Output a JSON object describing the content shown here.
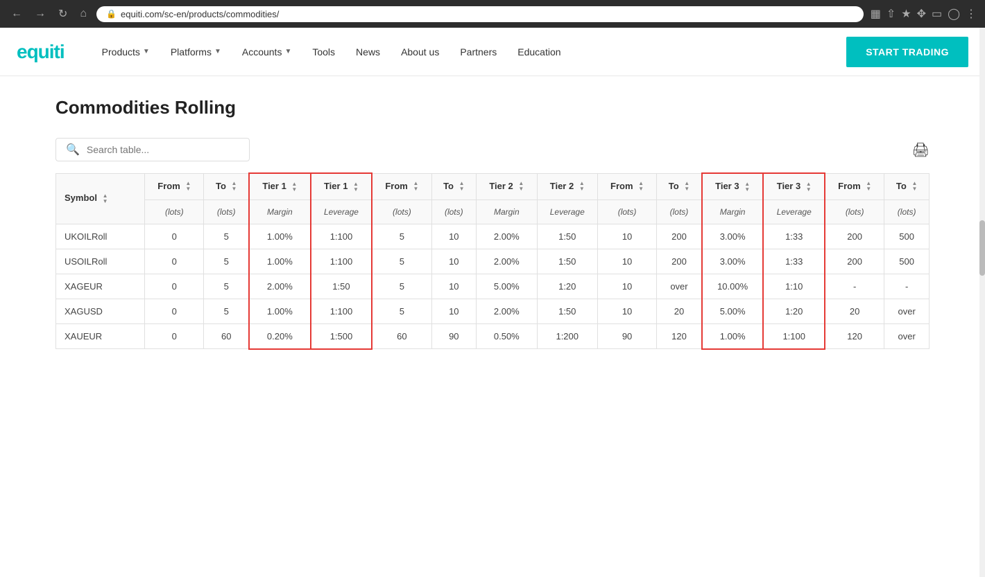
{
  "browser": {
    "url": "equiti.com/sc-en/products/commodities/",
    "back": "←",
    "forward": "→",
    "reload": "↻",
    "home": "⌂"
  },
  "nav": {
    "logo": "equiti",
    "links": [
      {
        "label": "Products",
        "has_dropdown": true
      },
      {
        "label": "Platforms",
        "has_dropdown": true
      },
      {
        "label": "Accounts",
        "has_dropdown": true
      },
      {
        "label": "Tools",
        "has_dropdown": false
      },
      {
        "label": "News",
        "has_dropdown": false
      },
      {
        "label": "About us",
        "has_dropdown": false
      },
      {
        "label": "Partners",
        "has_dropdown": false
      },
      {
        "label": "Education",
        "has_dropdown": false
      }
    ],
    "cta": "START TRADING"
  },
  "page": {
    "title": "Commodities Rolling",
    "search_placeholder": "Search table..."
  },
  "table": {
    "headers": [
      "Symbol",
      "From",
      "To",
      "Tier 1",
      "Tier 1",
      "From",
      "To",
      "Tier 2",
      "Tier 2",
      "From",
      "To",
      "Tier 3",
      "Tier 3",
      "From",
      "To"
    ],
    "sub_headers": [
      "",
      "(lots)",
      "(lots)",
      "Margin",
      "Leverage",
      "(lots)",
      "(lots)",
      "Margin",
      "Leverage",
      "(lots)",
      "(lots)",
      "Margin",
      "Leverage",
      "(lots)",
      "(lots)"
    ],
    "rows": [
      [
        "UKOILRoll",
        "0",
        "5",
        "1.00%",
        "1:100",
        "5",
        "10",
        "2.00%",
        "1:50",
        "10",
        "200",
        "3.00%",
        "1:33",
        "200",
        "500"
      ],
      [
        "USOILRoll",
        "0",
        "5",
        "1.00%",
        "1:100",
        "5",
        "10",
        "2.00%",
        "1:50",
        "10",
        "200",
        "3.00%",
        "1:33",
        "200",
        "500"
      ],
      [
        "XAGEUR",
        "0",
        "5",
        "2.00%",
        "1:50",
        "5",
        "10",
        "5.00%",
        "1:20",
        "10",
        "over",
        "10.00%",
        "1:10",
        "-",
        "-"
      ],
      [
        "XAGUSD",
        "0",
        "5",
        "1.00%",
        "1:100",
        "5",
        "10",
        "2.00%",
        "1:50",
        "10",
        "20",
        "5.00%",
        "1:20",
        "20",
        "over"
      ],
      [
        "XAUEUR",
        "0",
        "60",
        "0.20%",
        "1:500",
        "60",
        "90",
        "0.50%",
        "1:200",
        "90",
        "120",
        "1.00%",
        "1:100",
        "120",
        "over"
      ]
    ]
  }
}
